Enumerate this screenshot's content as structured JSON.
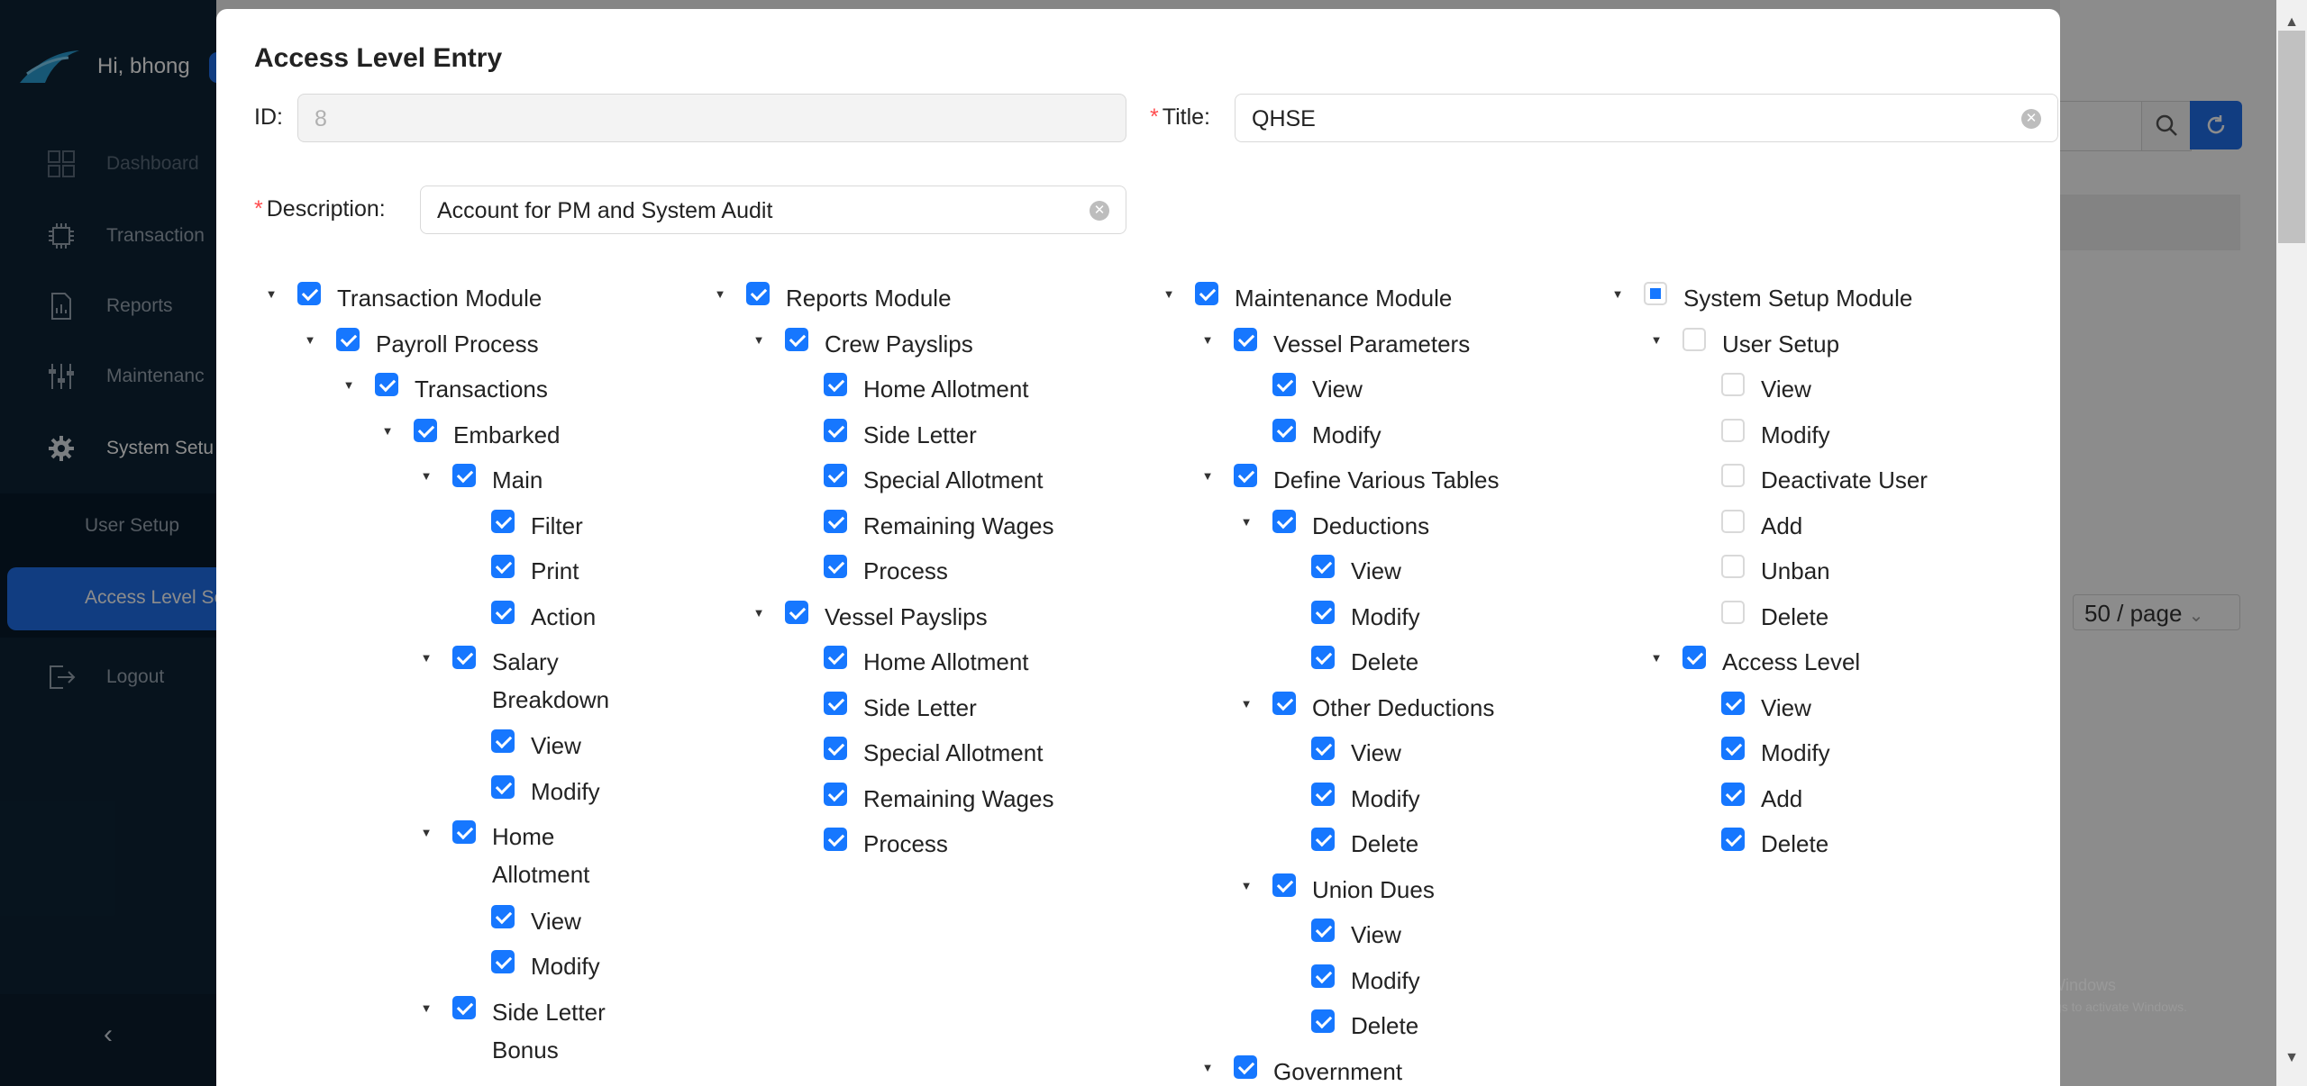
{
  "app": {
    "greeting": "Hi, bhong",
    "sidebar": [
      {
        "label": "Dashboard",
        "icon": "dashboard-icon"
      },
      {
        "label": "Transaction",
        "icon": "transaction-icon"
      },
      {
        "label": "Reports",
        "icon": "reports-icon"
      },
      {
        "label": "Maintenanc",
        "icon": "maintenance-icon"
      },
      {
        "label": "System Setu",
        "icon": "gear-icon"
      },
      {
        "label": "User Setup"
      },
      {
        "label": "Access Level Se"
      },
      {
        "label": "Logout",
        "icon": "logout-icon"
      }
    ],
    "pagesize": "50 / page",
    "watermark_title": "Activate Windows",
    "watermark_sub": "Go to Settings to activate Windows.",
    "accent": "#1677ff"
  },
  "modal": {
    "title": "Access Level Entry",
    "id_label": "ID",
    "id_value": "8",
    "title_label": "Title",
    "title_value": "QHSE",
    "description_label": "Description",
    "description_value": "Account for PM and System Audit"
  },
  "tree": [
    {
      "label": "Transaction Module",
      "state": "checked",
      "col": 0,
      "level": 0,
      "row": 0,
      "expanded": true
    },
    {
      "label": "Payroll Process",
      "state": "checked",
      "col": 0,
      "level": 1,
      "row": 1,
      "expanded": true
    },
    {
      "label": "Transactions",
      "state": "checked",
      "col": 0,
      "level": 2,
      "row": 2,
      "expanded": true
    },
    {
      "label": "Embarked",
      "state": "checked",
      "col": 0,
      "level": 3,
      "row": 3,
      "expanded": true
    },
    {
      "label": "Main",
      "state": "checked",
      "col": 0,
      "level": 4,
      "row": 4,
      "expanded": true
    },
    {
      "label": "Filter",
      "state": "checked",
      "col": 0,
      "level": 5,
      "row": 5
    },
    {
      "label": "Print",
      "state": "checked",
      "col": 0,
      "level": 5,
      "row": 6
    },
    {
      "label": "Action",
      "state": "checked",
      "col": 0,
      "level": 5,
      "row": 7
    },
    {
      "label": "Salary",
      "label2": "Breakdown",
      "state": "checked",
      "col": 0,
      "level": 4,
      "row": 8,
      "expanded": true
    },
    {
      "label": "View",
      "state": "checked",
      "col": 0,
      "level": 5,
      "row": 9.85
    },
    {
      "label": "Modify",
      "state": "checked",
      "col": 0,
      "level": 5,
      "row": 10.85
    },
    {
      "label": "Home",
      "label2": "Allotment",
      "state": "checked",
      "col": 0,
      "level": 4,
      "row": 11.85,
      "expanded": true
    },
    {
      "label": "View",
      "state": "checked",
      "col": 0,
      "level": 5,
      "row": 13.7
    },
    {
      "label": "Modify",
      "state": "checked",
      "col": 0,
      "level": 5,
      "row": 14.7
    },
    {
      "label": "Side Letter",
      "label2": "Bonus",
      "state": "checked",
      "col": 0,
      "level": 4,
      "row": 15.7,
      "expanded": true
    },
    {
      "label": "Reports Module",
      "state": "checked",
      "col": 1,
      "level": 0,
      "row": 0,
      "expanded": true
    },
    {
      "label": "Crew Payslips",
      "state": "checked",
      "col": 1,
      "level": 1,
      "row": 1,
      "expanded": true
    },
    {
      "label": "Home Allotment",
      "state": "checked",
      "col": 1,
      "level": 2,
      "row": 2
    },
    {
      "label": "Side Letter",
      "state": "checked",
      "col": 1,
      "level": 2,
      "row": 3
    },
    {
      "label": "Special Allotment",
      "state": "checked",
      "col": 1,
      "level": 2,
      "row": 4
    },
    {
      "label": "Remaining Wages",
      "state": "checked",
      "col": 1,
      "level": 2,
      "row": 5
    },
    {
      "label": "Process",
      "state": "checked",
      "col": 1,
      "level": 2,
      "row": 6
    },
    {
      "label": "Vessel Payslips",
      "state": "checked",
      "col": 1,
      "level": 1,
      "row": 7,
      "expanded": true
    },
    {
      "label": "Home Allotment",
      "state": "checked",
      "col": 1,
      "level": 2,
      "row": 8
    },
    {
      "label": "Side Letter",
      "state": "checked",
      "col": 1,
      "level": 2,
      "row": 9
    },
    {
      "label": "Special Allotment",
      "state": "checked",
      "col": 1,
      "level": 2,
      "row": 10
    },
    {
      "label": "Remaining Wages",
      "state": "checked",
      "col": 1,
      "level": 2,
      "row": 11
    },
    {
      "label": "Process",
      "state": "checked",
      "col": 1,
      "level": 2,
      "row": 12
    },
    {
      "label": "Maintenance Module",
      "state": "checked",
      "col": 2,
      "level": 0,
      "row": 0,
      "expanded": true
    },
    {
      "label": "Vessel Parameters",
      "state": "checked",
      "col": 2,
      "level": 1,
      "row": 1,
      "expanded": true
    },
    {
      "label": "View",
      "state": "checked",
      "col": 2,
      "level": 2,
      "row": 2
    },
    {
      "label": "Modify",
      "state": "checked",
      "col": 2,
      "level": 2,
      "row": 3
    },
    {
      "label": "Define Various Tables",
      "state": "checked",
      "col": 2,
      "level": 1,
      "row": 4,
      "expanded": true
    },
    {
      "label": "Deductions",
      "state": "checked",
      "col": 2,
      "level": 2,
      "row": 5,
      "expanded": true
    },
    {
      "label": "View",
      "state": "checked",
      "col": 2,
      "level": 3,
      "row": 6
    },
    {
      "label": "Modify",
      "state": "checked",
      "col": 2,
      "level": 3,
      "row": 7
    },
    {
      "label": "Delete",
      "state": "checked",
      "col": 2,
      "level": 3,
      "row": 8
    },
    {
      "label": "Other Deductions",
      "state": "checked",
      "col": 2,
      "level": 2,
      "row": 9,
      "expanded": true
    },
    {
      "label": "View",
      "state": "checked",
      "col": 2,
      "level": 3,
      "row": 10
    },
    {
      "label": "Modify",
      "state": "checked",
      "col": 2,
      "level": 3,
      "row": 11
    },
    {
      "label": "Delete",
      "state": "checked",
      "col": 2,
      "level": 3,
      "row": 12
    },
    {
      "label": "Union Dues",
      "state": "checked",
      "col": 2,
      "level": 2,
      "row": 13,
      "expanded": true
    },
    {
      "label": "View",
      "state": "checked",
      "col": 2,
      "level": 3,
      "row": 14
    },
    {
      "label": "Modify",
      "state": "checked",
      "col": 2,
      "level": 3,
      "row": 15
    },
    {
      "label": "Delete",
      "state": "checked",
      "col": 2,
      "level": 3,
      "row": 16
    },
    {
      "label": "Government",
      "state": "checked",
      "col": 2,
      "level": 1,
      "row": 17,
      "expanded": true
    },
    {
      "label": "System Setup Module",
      "state": "partial",
      "col": 3,
      "level": 0,
      "row": 0,
      "expanded": true
    },
    {
      "label": "User Setup",
      "state": "unchecked",
      "col": 3,
      "level": 1,
      "row": 1,
      "expanded": true
    },
    {
      "label": "View",
      "state": "unchecked",
      "col": 3,
      "level": 2,
      "row": 2
    },
    {
      "label": "Modify",
      "state": "unchecked",
      "col": 3,
      "level": 2,
      "row": 3
    },
    {
      "label": "Deactivate User",
      "state": "unchecked",
      "col": 3,
      "level": 2,
      "row": 4
    },
    {
      "label": "Add",
      "state": "unchecked",
      "col": 3,
      "level": 2,
      "row": 5
    },
    {
      "label": "Unban",
      "state": "unchecked",
      "col": 3,
      "level": 2,
      "row": 6
    },
    {
      "label": "Delete",
      "state": "unchecked",
      "col": 3,
      "level": 2,
      "row": 7
    },
    {
      "label": "Access Level",
      "state": "checked",
      "col": 3,
      "level": 1,
      "row": 8,
      "expanded": true
    },
    {
      "label": "View",
      "state": "checked",
      "col": 3,
      "level": 2,
      "row": 9
    },
    {
      "label": "Modify",
      "state": "checked",
      "col": 3,
      "level": 2,
      "row": 10
    },
    {
      "label": "Add",
      "state": "checked",
      "col": 3,
      "level": 2,
      "row": 11
    },
    {
      "label": "Delete",
      "state": "checked",
      "col": 3,
      "level": 2,
      "row": 12
    }
  ]
}
